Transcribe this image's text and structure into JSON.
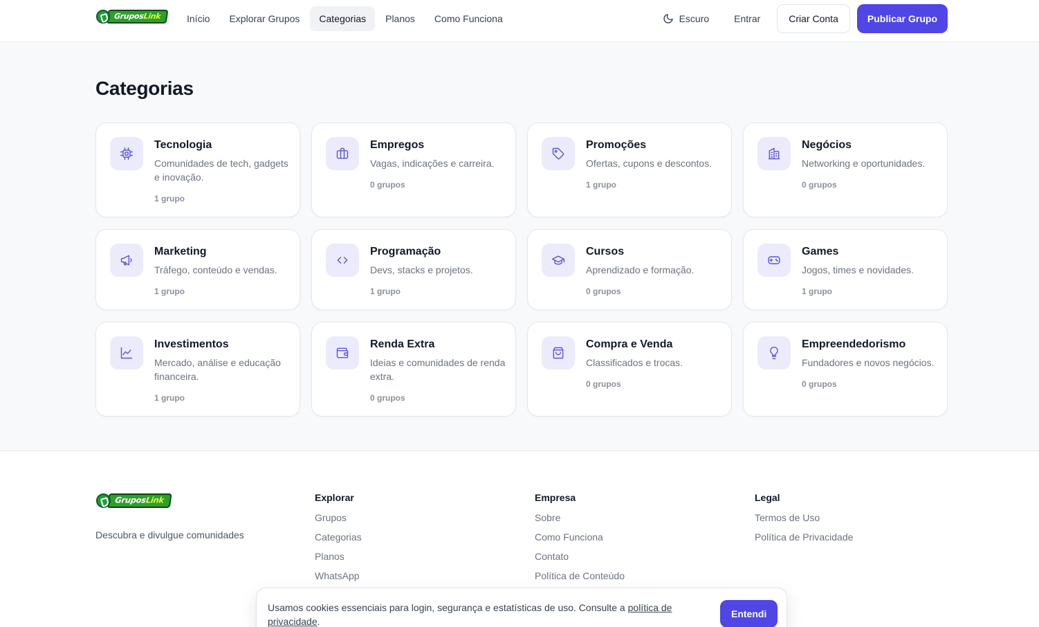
{
  "brand": {
    "logo_part1": "Grupos",
    "logo_part2": "Link",
    "accent": "#4f46e5"
  },
  "nav": {
    "items": [
      {
        "label": "Início"
      },
      {
        "label": "Explorar Grupos"
      },
      {
        "label": "Categorias",
        "active": true
      },
      {
        "label": "Planos"
      },
      {
        "label": "Como Funciona"
      }
    ]
  },
  "header_actions": {
    "theme_label": "Escuro",
    "theme_icon": "moon-icon",
    "login_label": "Entrar",
    "signup_label": "Criar Conta",
    "publish_label": "Publicar Grupo"
  },
  "page": {
    "title": "Categorias"
  },
  "categories": [
    {
      "icon": "cpu-icon",
      "name": "Tecnologia",
      "description": "Comunidades de tech, gadgets e inovação.",
      "count": "1 grupo"
    },
    {
      "icon": "briefcase-icon",
      "name": "Empregos",
      "description": "Vagas, indicações e carreira.",
      "count": "0 grupos"
    },
    {
      "icon": "tag-icon",
      "name": "Promoções",
      "description": "Ofertas, cupons e descontos.",
      "count": "1 grupo"
    },
    {
      "icon": "building-icon",
      "name": "Negócios",
      "description": "Networking e oportunidades.",
      "count": "0 grupos"
    },
    {
      "icon": "megaphone-icon",
      "name": "Marketing",
      "description": "Tráfego, conteúdo e vendas.",
      "count": "1 grupo"
    },
    {
      "icon": "code-icon",
      "name": "Programação",
      "description": "Devs, stacks e projetos.",
      "count": "1 grupo"
    },
    {
      "icon": "graduation-cap-icon",
      "name": "Cursos",
      "description": "Aprendizado e formação.",
      "count": "0 grupos"
    },
    {
      "icon": "gamepad-icon",
      "name": "Games",
      "description": "Jogos, times e novidades.",
      "count": "1 grupo"
    },
    {
      "icon": "chart-line-icon",
      "name": "Investimentos",
      "description": "Mercado, análise e educação financeira.",
      "count": "1 grupo"
    },
    {
      "icon": "wallet-icon",
      "name": "Renda Extra",
      "description": "Ideias e comunidades de renda extra.",
      "count": "0 grupos"
    },
    {
      "icon": "shopping-bag-icon",
      "name": "Compra e Venda",
      "description": "Classificados e trocas.",
      "count": "0 grupos"
    },
    {
      "icon": "lightbulb-icon",
      "name": "Empreendedorismo",
      "description": "Fundadores e novos negócios.",
      "count": "0 grupos"
    }
  ],
  "footer": {
    "tagline": "Descubra e divulgue comunidades",
    "columns": [
      {
        "title": "Explorar",
        "links": [
          "Grupos",
          "Categorias",
          "Planos",
          "WhatsApp"
        ]
      },
      {
        "title": "Empresa",
        "links": [
          "Sobre",
          "Como Funciona",
          "Contato",
          "Política de Conteúdo"
        ]
      },
      {
        "title": "Legal",
        "links": [
          "Termos de Uso",
          "Política de Privacidade"
        ]
      }
    ]
  },
  "cookie": {
    "text": "Usamos cookies essenciais para login, segurança e estatísticas de uso. Consulte a ",
    "link_text": "política de privacidade",
    "text_end": ".",
    "button_label": "Entendi"
  }
}
